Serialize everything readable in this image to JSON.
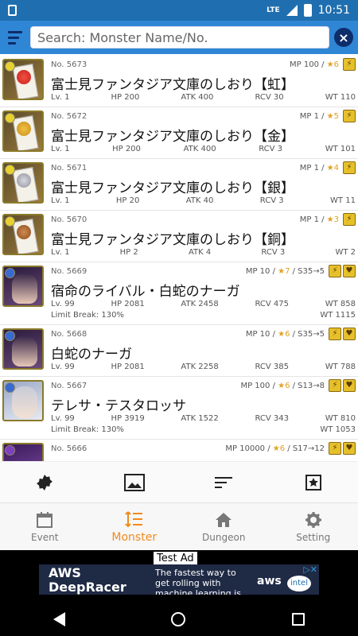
{
  "status_bar": {
    "network": "LTE",
    "time": "10:51"
  },
  "toolbar": {
    "search_placeholder": "Search: Monster Name/No."
  },
  "monsters": [
    {
      "no": "No. 5673",
      "mp": "MP 100 / ",
      "rarity": "★6",
      "name": "富士見ファンタジア文庫のしおり【虹】",
      "lv": "Lv. 1",
      "hp": "HP 200",
      "atk": "ATK 400",
      "rcv": "RCV 30",
      "wt": "WT 110",
      "limit_break": "",
      "wt_lb": "",
      "skill": ""
    },
    {
      "no": "No. 5672",
      "mp": "MP 1 / ",
      "rarity": "★5",
      "name": "富士見ファンタジア文庫のしおり【金】",
      "lv": "Lv. 1",
      "hp": "HP 200",
      "atk": "ATK 400",
      "rcv": "RCV 3",
      "wt": "WT 101",
      "limit_break": "",
      "wt_lb": "",
      "skill": ""
    },
    {
      "no": "No. 5671",
      "mp": "MP 1 / ",
      "rarity": "★4",
      "name": "富士見ファンタジア文庫のしおり【銀】",
      "lv": "Lv. 1",
      "hp": "HP 20",
      "atk": "ATK 40",
      "rcv": "RCV 3",
      "wt": "WT 11",
      "limit_break": "",
      "wt_lb": "",
      "skill": ""
    },
    {
      "no": "No. 5670",
      "mp": "MP 1 / ",
      "rarity": "★3",
      "name": "富士見ファンタジア文庫のしおり【銅】",
      "lv": "Lv. 1",
      "hp": "HP 2",
      "atk": "ATK 4",
      "rcv": "RCV 3",
      "wt": "WT 2",
      "limit_break": "",
      "wt_lb": "",
      "skill": ""
    },
    {
      "no": "No. 5669",
      "mp": "MP 10 / ",
      "rarity": "★7",
      "name": "宿命のライバル・白蛇のナーガ",
      "lv": "Lv. 99",
      "hp": "HP 2081",
      "atk": "ATK 2458",
      "rcv": "RCV 475",
      "wt": "WT 858",
      "limit_break": "Limit Break: 130%",
      "wt_lb": "WT 1115",
      "skill": " / S35→5"
    },
    {
      "no": "No. 5668",
      "mp": "MP 10 / ",
      "rarity": "★6",
      "name": "白蛇のナーガ",
      "lv": "Lv. 99",
      "hp": "HP 2081",
      "atk": "ATK 2258",
      "rcv": "RCV 385",
      "wt": "WT 788",
      "limit_break": "",
      "wt_lb": "",
      "skill": " / S35→5"
    },
    {
      "no": "No. 5667",
      "mp": "MP 100 / ",
      "rarity": "★6",
      "name": "テレサ・テスタロッサ",
      "lv": "Lv. 99",
      "hp": "HP 3919",
      "atk": "ATK 1522",
      "rcv": "RCV 343",
      "wt": "WT 810",
      "limit_break": "Limit Break: 130%",
      "wt_lb": "WT 1053",
      "skill": " / S13→8"
    },
    {
      "no": "No. 5666",
      "mp": "MP 10000 / ",
      "rarity": "★6",
      "name": "",
      "lv": "",
      "hp": "",
      "atk": "",
      "rcv": "",
      "wt": "",
      "limit_break": "",
      "wt_lb": "",
      "skill": " / S17→12"
    }
  ],
  "nav": {
    "event": "Event",
    "monster": "Monster",
    "dungeon": "Dungeon",
    "setting": "Setting"
  },
  "ad": {
    "label": "Test Ad",
    "headline": "AWS DeepRacer League",
    "body": "The fastest way to get rolling with machine learning is literally",
    "brand": "aws",
    "partner": "intel"
  }
}
